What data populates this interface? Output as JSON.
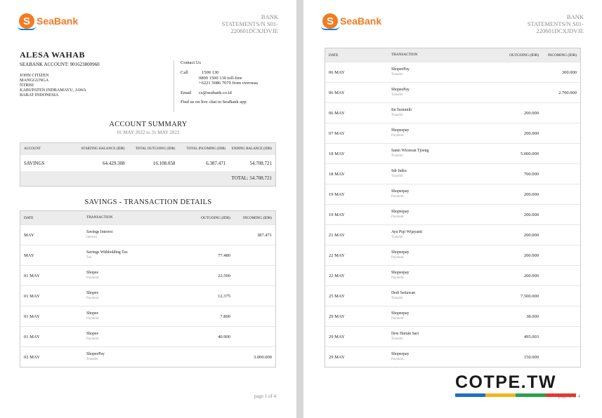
{
  "brand": {
    "logo_glyph": "S",
    "name": "SeaBank",
    "orange": "#f47a20",
    "blue": "#1b7fd6"
  },
  "statement": {
    "line1": "BANK",
    "line2": "STATEMENTS/N  S01-",
    "line3": "220601DCXJDVJE"
  },
  "customer": {
    "name": "ALESA WAHAB",
    "account": "SEABANK ACCOUNT: 901623800960",
    "address": [
      "JOHN CITIZEN",
      "MANGGUNGA",
      "NTRISI",
      "KABUPATEN INDRAMAYU, JAWA",
      "BARAT INDONESIA"
    ]
  },
  "contact": {
    "title": "Contact Us",
    "call_label": "Call",
    "call_lines": [
      "1500 130",
      "0800 1500 130 toll-free",
      "+6221 5086 7070 from overseas"
    ],
    "email_label": "Email",
    "email": "cs@seabank.co.id",
    "chat": "Find us on live chat in SeaBank app"
  },
  "summary": {
    "title": "ACCOUNT SUMMARY",
    "period": "01 MAY 2022 to 31 MAY 2022",
    "headers": [
      "ACCOUNT",
      "STARTING BALANCE (IDR)",
      "TOTAL OUTGOING (IDR)",
      "TOTAL INCOMING (IDR)",
      "ENDING BALANCE (IDR)"
    ],
    "row": [
      "SAVINGS",
      "64.429.308",
      "16.108.058",
      "6.387.471",
      "54.708.721"
    ],
    "total": "TOTAL: 54.708.721"
  },
  "details": {
    "title": "SAVINGS - TRANSACTION DETAILS",
    "headers": [
      "DATE",
      "TRANSACTION",
      "OUTGOING (IDR)",
      "INCOMING (IDR)"
    ],
    "page1_rows": [
      {
        "date": "MAY",
        "desc": "Savings Interest",
        "type": "Interest",
        "out": "",
        "in": "387.471"
      },
      {
        "date": "MAY",
        "desc": "Savings Withholding Tax",
        "type": "Tax",
        "out": "77.480",
        "in": ""
      },
      {
        "date": "01 MAY",
        "desc": "Shopee",
        "type": "Payment",
        "out": "22.500",
        "in": ""
      },
      {
        "date": "01 MAY",
        "desc": "Shopee",
        "type": "Payment",
        "out": "12.375",
        "in": ""
      },
      {
        "date": "01 MAY",
        "desc": "Shopee",
        "type": "Payment",
        "out": "7.800",
        "in": ""
      },
      {
        "date": "01 MAY",
        "desc": "Shopee",
        "type": "Payment",
        "out": "40.900",
        "in": ""
      },
      {
        "date": "02 MAY",
        "desc": "ShopeePay",
        "type": "Transfer",
        "out": "",
        "in": "3.000.000"
      }
    ],
    "page2_rows": [
      {
        "date": "06 MAY",
        "desc": "ShopeePay",
        "type": "Transfer",
        "out": "",
        "in": "300.000"
      },
      {
        "date": "06 MAY",
        "desc": "ShopeePay",
        "type": "Transfer",
        "out": "",
        "in": "2.700.000"
      },
      {
        "date": "06 MAY",
        "desc": "Iin Tarminih",
        "type": "Transfer",
        "out": "200.000",
        "in": ""
      },
      {
        "date": "07 MAY",
        "desc": "Shopeepay",
        "type": "Payment",
        "out": "200.000",
        "in": ""
      },
      {
        "date": "18 MAY",
        "desc": "Santo Wirawan Tjoeng",
        "type": "Transfer",
        "out": "5.000.000",
        "in": ""
      },
      {
        "date": "18 MAY",
        "desc": "Sdr Indra",
        "type": "Transfer",
        "out": "700.000",
        "in": ""
      },
      {
        "date": "19 MAY",
        "desc": "Shopeepay",
        "type": "Payment",
        "out": "200.000",
        "in": ""
      },
      {
        "date": "19 MAY",
        "desc": "Shopeepay",
        "type": "Payment",
        "out": "200.000",
        "in": ""
      },
      {
        "date": "21 MAY",
        "desc": "Ayu Puji Wijayanti",
        "type": "Transfer",
        "out": "200.000",
        "in": ""
      },
      {
        "date": "22 MAY",
        "desc": "Shopeepay",
        "type": "Payment",
        "out": "200.000",
        "in": ""
      },
      {
        "date": "22 MAY",
        "desc": "Shopeepay",
        "type": "Payment",
        "out": "200.000",
        "in": ""
      },
      {
        "date": "25 MAY",
        "desc": "Dedi Setiawan",
        "type": "Transfer",
        "out": "7.500.000",
        "in": ""
      },
      {
        "date": "29 MAY",
        "desc": "Shopeepay",
        "type": "Payment",
        "out": "38.000",
        "in": ""
      },
      {
        "date": "29 MAY",
        "desc": "Desi Harum Sari",
        "type": "Transfer",
        "out": "495.003",
        "in": ""
      },
      {
        "date": "29 MAY",
        "desc": "Shopeepay",
        "type": "Payment",
        "out": "150.000",
        "in": ""
      }
    ]
  },
  "pages": {
    "p1": "page 1 of 4",
    "p2": "page 2 of 4"
  },
  "watermark": {
    "text": "COTPE.TW",
    "colors": [
      "#1e6fc7",
      "#f2b51c",
      "#27a34a",
      "#e23a2e"
    ]
  }
}
